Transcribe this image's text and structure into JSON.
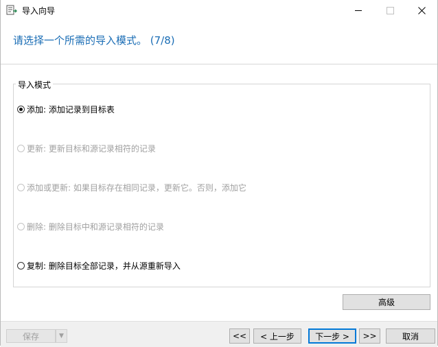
{
  "window": {
    "title": "导入向导",
    "heading": "请选择一个所需的导入模式。 (7/8)",
    "controls": {
      "minimize_glyph": "—",
      "maximize_glyph": "☐",
      "close_glyph": "✕"
    }
  },
  "import_mode": {
    "legend": "导入模式",
    "options": [
      {
        "label": "添加: 添加记录到目标表",
        "selected": true,
        "enabled": true
      },
      {
        "label": "更新: 更新目标和源记录相符的记录",
        "selected": false,
        "enabled": false
      },
      {
        "label": "添加或更新: 如果目标存在相同记录，更新它。否则，添加它",
        "selected": false,
        "enabled": false
      },
      {
        "label": "删除: 删除目标中和源记录相符的记录",
        "selected": false,
        "enabled": false
      },
      {
        "label": "复制: 删除目标全部记录，并从源重新导入",
        "selected": false,
        "enabled": true
      }
    ]
  },
  "buttons": {
    "advanced": "高级",
    "save": "保存",
    "save_dropdown_glyph": "▼",
    "first": "<<",
    "prev": "< 上一步",
    "next": "下一步 >",
    "last": ">>",
    "cancel": "取消"
  },
  "colors": {
    "heading_text": "#1a6db5",
    "primary_border": "#0078d7",
    "disabled_text": "#a0a0a0"
  }
}
